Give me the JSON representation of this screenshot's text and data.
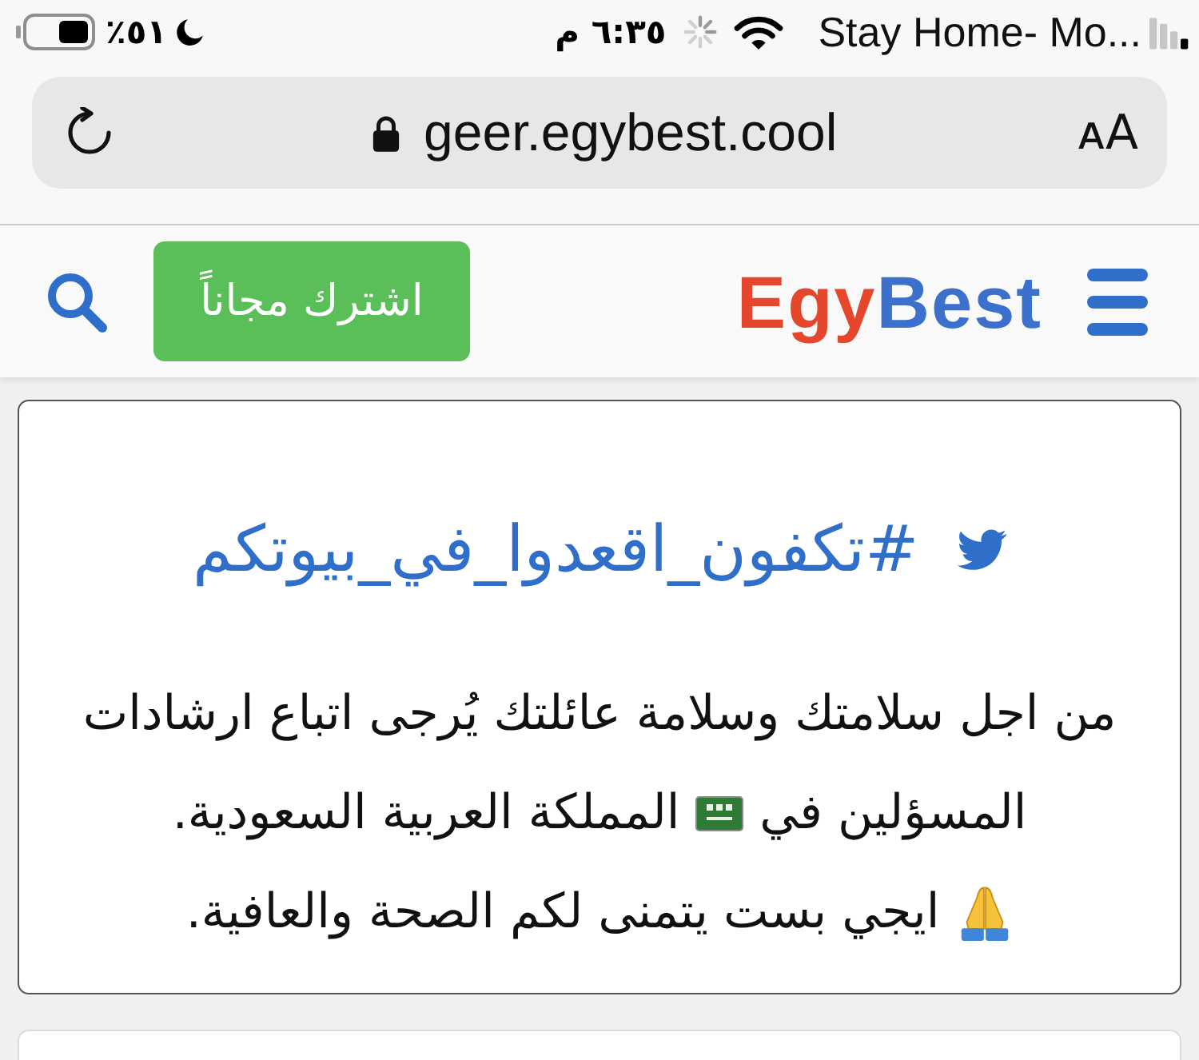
{
  "status_bar": {
    "battery_percent": "٥١٪",
    "time": "٦:٣٥ م",
    "carrier": "Stay Home- Mo..."
  },
  "address_bar": {
    "url": "geer.egybest.cool",
    "text_size_button": "ᴀA"
  },
  "site_header": {
    "logo": {
      "prefix": "Egy",
      "suffix": "Best"
    },
    "subscribe_button": "اشترك مجاناً"
  },
  "notice_card": {
    "hashtag": "#تكفون_اقعدوا_في_بيوتكم",
    "lines": [
      [
        {
          "kind": "text",
          "text": "من اجل سلامتك وسلامة عائلتك يُرجى اتباع ارشادات"
        }
      ],
      [
        {
          "kind": "text",
          "text": "المسؤلين في"
        },
        {
          "kind": "flag_emoji"
        },
        {
          "kind": "text",
          "text": "المملكة العربية السعودية."
        }
      ],
      [
        {
          "kind": "praying_hands_emoji"
        },
        {
          "kind": "text",
          "text": "ايجي بست يتمنى لكم الصحة والعافية."
        }
      ]
    ]
  }
}
